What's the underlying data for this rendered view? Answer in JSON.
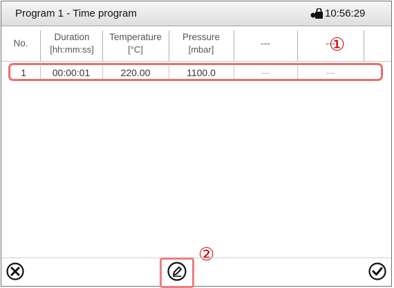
{
  "header": {
    "title": "Program 1 - Time program",
    "time": "10:56:29"
  },
  "table": {
    "columns": [
      {
        "label": "No.",
        "unit": ""
      },
      {
        "label": "Duration",
        "unit": "[hh:mm:ss]"
      },
      {
        "label": "Temperature",
        "unit": "[°C]"
      },
      {
        "label": "Pressure",
        "unit": "[mbar]"
      },
      {
        "label": "---",
        "unit": ""
      },
      {
        "label": "---",
        "unit": ""
      }
    ],
    "rows": [
      {
        "no": "1",
        "duration": "00:00:01",
        "temperature": "220.00",
        "pressure": "1100.0",
        "col5": "---",
        "col6": "---"
      }
    ]
  },
  "annotations": {
    "marker1": "①",
    "marker2": "②"
  },
  "icons": {
    "lock": "lock-icon",
    "cancel": "cancel-icon",
    "edit": "edit-icon",
    "confirm": "confirm-icon"
  },
  "colors": {
    "highlight": "#e76e6e",
    "marker": "#d00000"
  }
}
